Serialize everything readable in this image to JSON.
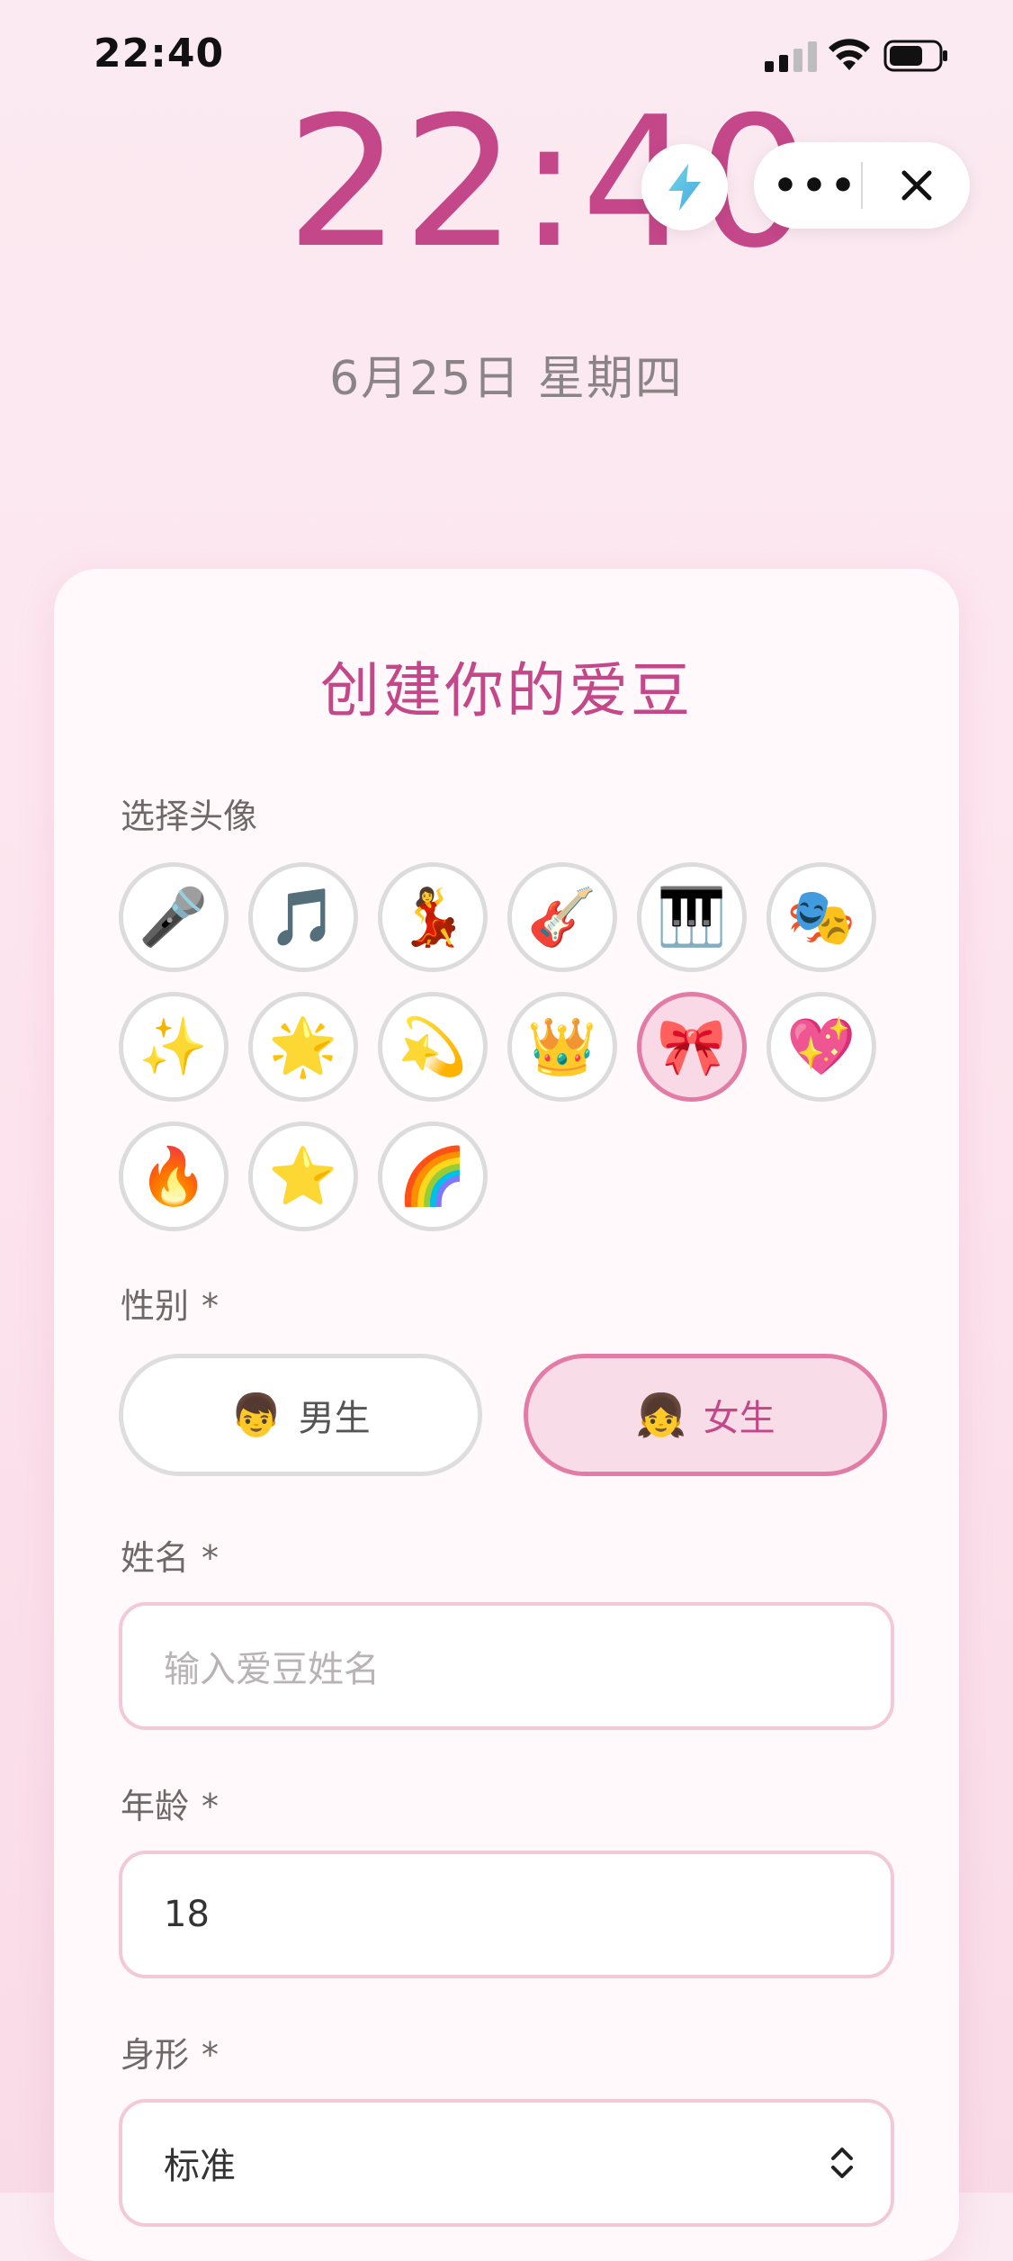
{
  "status_bar": {
    "time": "22:40"
  },
  "clock": {
    "time": "22:40",
    "date": "6月25日 星期四"
  },
  "capsule": {
    "more": "•••"
  },
  "form": {
    "title": "创建你的爱豆",
    "avatar_label": "选择头像",
    "avatars": [
      {
        "emoji": "🎤",
        "name": "microphone"
      },
      {
        "emoji": "🎵",
        "name": "music-note"
      },
      {
        "emoji": "💃",
        "name": "dancer"
      },
      {
        "emoji": "🎸",
        "name": "guitar"
      },
      {
        "emoji": "🎹",
        "name": "piano"
      },
      {
        "emoji": "🎭",
        "name": "theater-masks"
      },
      {
        "emoji": "✨",
        "name": "sparkles"
      },
      {
        "emoji": "🌟",
        "name": "glowing-star"
      },
      {
        "emoji": "💫",
        "name": "dizzy"
      },
      {
        "emoji": "👑",
        "name": "crown"
      },
      {
        "emoji": "🎀",
        "name": "ribbon"
      },
      {
        "emoji": "💖",
        "name": "sparkling-heart"
      },
      {
        "emoji": "🔥",
        "name": "fire"
      },
      {
        "emoji": "⭐",
        "name": "star"
      },
      {
        "emoji": "🌈",
        "name": "rainbow"
      }
    ],
    "selected_avatar": "ribbon",
    "gender_label": "性别",
    "gender_options": [
      {
        "emoji": "👦",
        "label": "男生"
      },
      {
        "emoji": "👧",
        "label": "女生"
      }
    ],
    "selected_gender": "女生",
    "name_label": "姓名",
    "name_placeholder": "输入爱豆姓名",
    "age_label": "年龄",
    "age_value": "18",
    "body_label": "身形",
    "body_value": "标准",
    "required_mark": "*"
  },
  "colors": {
    "accent": "#c4478a",
    "border_pink": "#e27ca6",
    "bg": "#fde6ef"
  }
}
